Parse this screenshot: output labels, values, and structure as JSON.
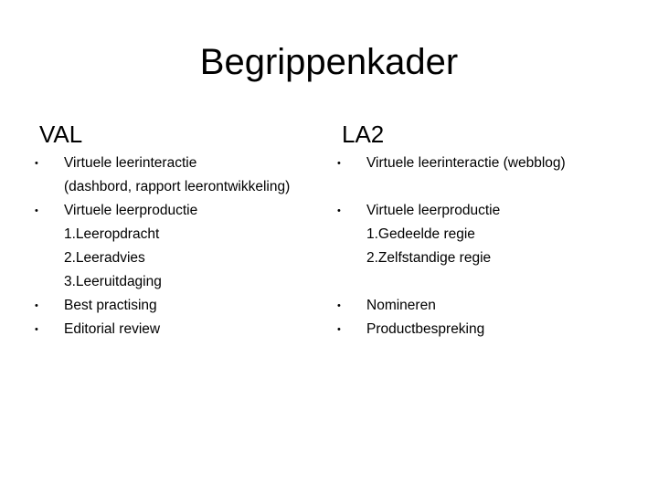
{
  "slide": {
    "title": "Begrippenkader",
    "left": {
      "heading": "VAL",
      "lines": [
        {
          "bullet": "•",
          "text": "Virtuele leerinteractie"
        },
        {
          "bullet": "",
          "text": "(dashbord, rapport leerontwikkeling)"
        },
        {
          "bullet": "•",
          "text": "Virtuele leerproductie"
        },
        {
          "bullet": "",
          "text": "1.Leeropdracht"
        },
        {
          "bullet": "",
          "text": "2.Leeradvies"
        },
        {
          "bullet": "",
          "text": "3.Leeruitdaging"
        },
        {
          "bullet": "•",
          "text": "Best practising"
        },
        {
          "bullet": "•",
          "text": "Editorial review"
        }
      ]
    },
    "right": {
      "heading": "LA2",
      "lines": [
        {
          "bullet": "•",
          "text": "Virtuele leerinteractie (webblog)"
        },
        {
          "bullet": "",
          "text": ""
        },
        {
          "bullet": "•",
          "text": "Virtuele leerproductie"
        },
        {
          "bullet": "",
          "text": "1.Gedeelde regie"
        },
        {
          "bullet": "",
          "text": "2.Zelfstandige regie"
        },
        {
          "bullet": "",
          "text": ""
        },
        {
          "bullet": "•",
          "text": "Nomineren"
        },
        {
          "bullet": "•",
          "text": "Productbespreking"
        }
      ]
    }
  }
}
